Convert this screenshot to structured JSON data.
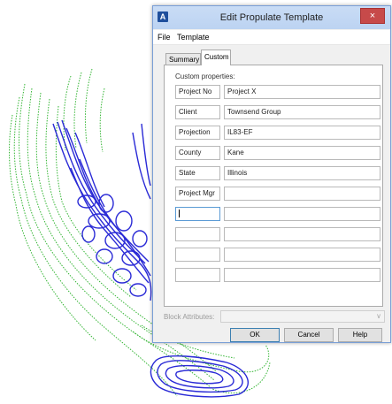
{
  "window": {
    "title": "Edit Propulate Template",
    "app_icon": "A",
    "close_glyph": "×"
  },
  "menu": [
    "File",
    "Template"
  ],
  "tabs": [
    {
      "label": "Summary",
      "active": false
    },
    {
      "label": "Custom",
      "active": true
    }
  ],
  "custom": {
    "heading": "Custom properties:",
    "rows": [
      {
        "name": "Project No",
        "value": "Project X"
      },
      {
        "name": "Client",
        "value": "Townsend Group"
      },
      {
        "name": "Projection",
        "value": "IL83-EF"
      },
      {
        "name": "County",
        "value": "Kane"
      },
      {
        "name": "State",
        "value": "Illinois"
      },
      {
        "name": "Project Mgr",
        "value": ""
      },
      {
        "name": "",
        "value": ""
      },
      {
        "name": "",
        "value": ""
      },
      {
        "name": "",
        "value": ""
      },
      {
        "name": "",
        "value": ""
      }
    ]
  },
  "block_attributes": {
    "label": "Block Attributes:",
    "value": ""
  },
  "buttons": {
    "ok": "OK",
    "cancel": "Cancel",
    "help": "Help"
  },
  "colors": {
    "contour_green": "#33b533",
    "contour_blue": "#2a2ad6",
    "title_bar": "#c9dcf5",
    "close_red": "#c74a4a"
  }
}
